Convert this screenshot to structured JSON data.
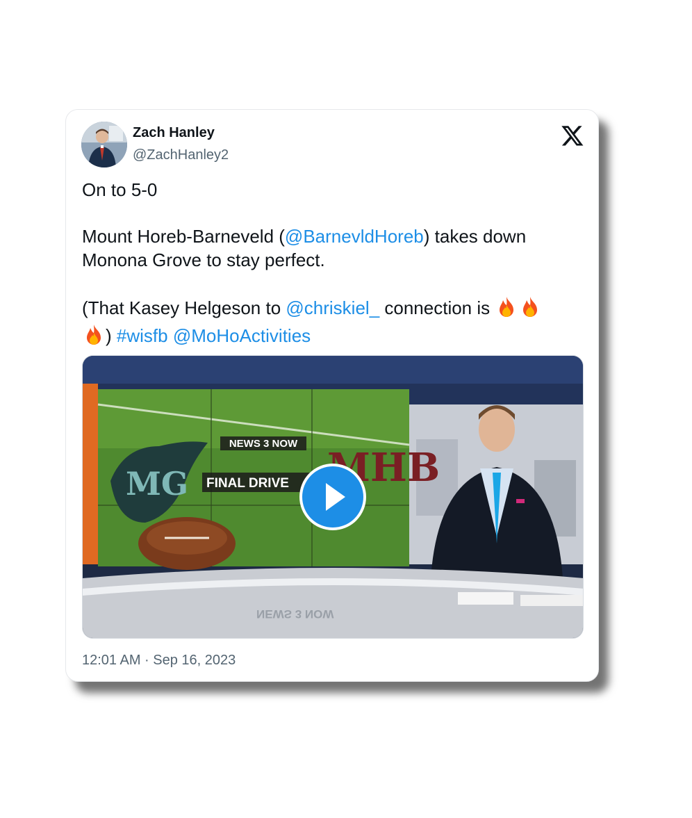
{
  "tweet": {
    "author": {
      "name": "Zach Hanley",
      "handle": "@ZachHanley2",
      "avatar_icon": "profile-photo"
    },
    "logo_icon": "x-logo-icon",
    "text": {
      "line1": "On to 5-0",
      "p2_before": "Mount Horeb-Barneveld (",
      "mention1": "@BarnevldHoreb",
      "p2_after": ") takes down Monona Grove to stay perfect.",
      "p3_before": "(That Kasey Helgeson to ",
      "mention2": "@chriskiel_",
      "p3_mid": " connection is ",
      "p3_close": ")",
      "hashtag": "#wisfb",
      "mention3": "@MoHoActivities"
    },
    "media": {
      "type": "video",
      "play_icon": "play-icon",
      "screen_logo": "NEWS 3 NOW",
      "screen_title": "FINAL DRIVE",
      "team_left": "MG",
      "team_right": "MHB",
      "desk_text": "NEWS 3 NOW"
    },
    "timestamp": "12:01 AM · Sep 16, 2023"
  },
  "colors": {
    "link": "#1d8ee6",
    "text": "#0f1419",
    "muted": "#536471"
  }
}
